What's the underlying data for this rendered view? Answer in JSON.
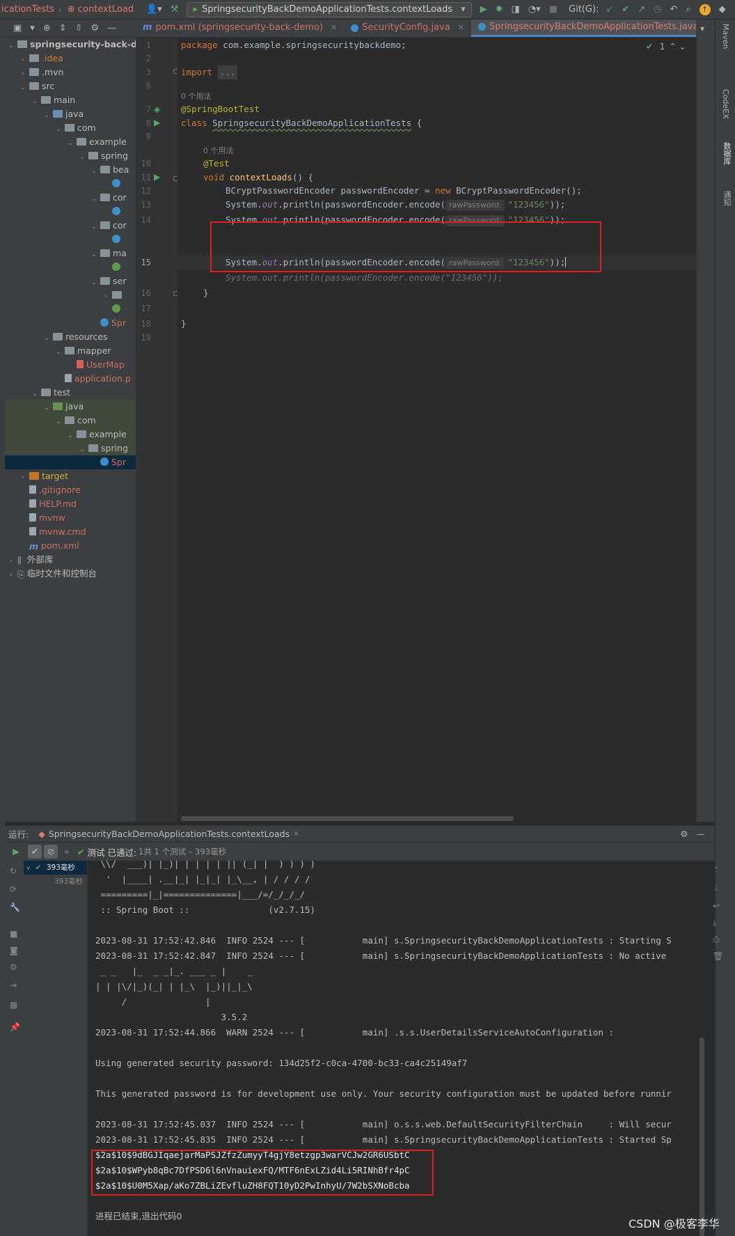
{
  "toolbar": {
    "breadcrumb_file": "icationTests",
    "breadcrumb_method": "contextLoad",
    "run_config": "SpringsecurityBackDemoApplicationTests.contextLoads",
    "git_label": "Git(G):"
  },
  "project_tree": [
    {
      "indent": 0,
      "arrow": "v",
      "icon": "folder",
      "label": "springsecurity-back-demo",
      "bold": true
    },
    {
      "indent": 1,
      "arrow": ">",
      "icon": "folder",
      "label": ".idea",
      "color": "orange"
    },
    {
      "indent": 1,
      "arrow": ">",
      "icon": "folder",
      "label": ".mvn"
    },
    {
      "indent": 1,
      "arrow": "v",
      "icon": "folder",
      "label": "src"
    },
    {
      "indent": 2,
      "arrow": "v",
      "icon": "folder",
      "label": "main"
    },
    {
      "indent": 3,
      "arrow": "v",
      "icon": "folder-blue",
      "label": "java"
    },
    {
      "indent": 4,
      "arrow": "v",
      "icon": "folder",
      "label": "com"
    },
    {
      "indent": 5,
      "arrow": "v",
      "icon": "folder",
      "label": "example"
    },
    {
      "indent": 6,
      "arrow": "v",
      "icon": "folder",
      "label": "spring"
    },
    {
      "indent": 7,
      "arrow": "v",
      "icon": "folder",
      "label": "bea"
    },
    {
      "indent": 8,
      "arrow": "",
      "icon": "class",
      "label": ""
    },
    {
      "indent": 7,
      "arrow": "v",
      "icon": "folder",
      "label": "cor"
    },
    {
      "indent": 8,
      "arrow": "",
      "icon": "class",
      "label": ""
    },
    {
      "indent": 7,
      "arrow": "v",
      "icon": "folder",
      "label": "cor"
    },
    {
      "indent": 8,
      "arrow": "",
      "icon": "class",
      "label": ""
    },
    {
      "indent": 7,
      "arrow": "v",
      "icon": "folder",
      "label": "ma"
    },
    {
      "indent": 8,
      "arrow": "",
      "icon": "iface",
      "label": ""
    },
    {
      "indent": 7,
      "arrow": "v",
      "icon": "folder",
      "label": "ser"
    },
    {
      "indent": 8,
      "arrow": ">",
      "icon": "folder",
      "label": ""
    },
    {
      "indent": 8,
      "arrow": "",
      "icon": "iface",
      "label": ""
    },
    {
      "indent": 7,
      "arrow": "",
      "icon": "class",
      "label": "Spr",
      "color": "red"
    },
    {
      "indent": 3,
      "arrow": "v",
      "icon": "folder",
      "label": "resources"
    },
    {
      "indent": 4,
      "arrow": "v",
      "icon": "folder",
      "label": "mapper"
    },
    {
      "indent": 5,
      "arrow": "",
      "icon": "xml",
      "label": "UserMap",
      "color": "red"
    },
    {
      "indent": 4,
      "arrow": "",
      "icon": "file",
      "label": "application.p",
      "color": "red"
    },
    {
      "indent": 2,
      "arrow": "v",
      "icon": "folder",
      "label": "test"
    },
    {
      "indent": 3,
      "arrow": "v",
      "icon": "folder-green",
      "label": "java",
      "hl": "green"
    },
    {
      "indent": 4,
      "arrow": "v",
      "icon": "folder",
      "label": "com",
      "hl": "green"
    },
    {
      "indent": 5,
      "arrow": "v",
      "icon": "folder",
      "label": "example",
      "hl": "green"
    },
    {
      "indent": 6,
      "arrow": "v",
      "icon": "folder",
      "label": "spring",
      "hl": "green"
    },
    {
      "indent": 7,
      "arrow": "",
      "icon": "class",
      "label": "Spr",
      "color": "red",
      "hl": "sel"
    },
    {
      "indent": 1,
      "arrow": ">",
      "icon": "folder-orange",
      "label": "target",
      "color": "yellow"
    },
    {
      "indent": 1,
      "arrow": "",
      "icon": "file",
      "label": ".gitignore",
      "color": "red"
    },
    {
      "indent": 1,
      "arrow": "",
      "icon": "file",
      "label": "HELP.md",
      "color": "red"
    },
    {
      "indent": 1,
      "arrow": "",
      "icon": "file",
      "label": "mvnw",
      "color": "red"
    },
    {
      "indent": 1,
      "arrow": "",
      "icon": "file",
      "label": "mvnw.cmd",
      "color": "red"
    },
    {
      "indent": 1,
      "arrow": "",
      "icon": "m",
      "label": "pom.xml",
      "color": "red"
    },
    {
      "indent": 0,
      "arrow": ">",
      "icon": "lib",
      "label": "外部库"
    },
    {
      "indent": 0,
      "arrow": ">",
      "icon": "scratch",
      "label": "临时文件和控制台"
    }
  ],
  "editor_tabs": [
    {
      "icon": "m",
      "label": "pom.xml (springsecurity-back-demo)",
      "active": false
    },
    {
      "icon": "class",
      "label": "SecurityConfig.java",
      "active": false
    },
    {
      "icon": "class",
      "label": "SpringsecurityBackDemoApplicationTests.java",
      "active": true
    }
  ],
  "editor": {
    "inspection_count": "1",
    "package_kw": "package",
    "package_name": "com.example.springsecuritybackdemo;",
    "import_kw": "import",
    "import_fold": "...",
    "usages_0": "0 个用法",
    "annotation_boot": "@SpringBootTest",
    "class_kw": "class",
    "class_name": "SpringsecurityBackDemoApplicationTests",
    "brace_open": " {",
    "annotation_test": "@Test",
    "void_kw": "void",
    "method_name": "contextLoads",
    "method_tail": "() {",
    "encoder_decl_type": "BCryptPasswordEncoder passwordEncoder = ",
    "new_kw": "new",
    "encoder_ctor": " BCryptPasswordEncoder();",
    "print_prefix": "System.",
    "print_out": "out",
    "print_mid": ".println(passwordEncoder.encode(",
    "param_hint": "rawPassword:",
    "pwd_literal": "\"123456\"",
    "print_end": "));",
    "ghost_line": "System.out.println(passwordEncoder.encode(\"123456\"));",
    "close_brace": "}",
    "line_numbers": [
      "1",
      "2",
      "3",
      "6",
      "7",
      "8",
      "9",
      "10",
      "11",
      "12",
      "13",
      "14",
      "15",
      "16",
      "17",
      "18",
      "19"
    ]
  },
  "run_panel": {
    "label": "运行:",
    "tab": "SpringsecurityBackDemoApplicationTests.contextLoads",
    "status_prefix": "测试 已通过:",
    "status_detail": "1共 1 个测试 – 393毫秒",
    "tree_item_1": "393毫秒",
    "tree_item_2": "393毫秒",
    "console_lines": [
      " \\\\/  ___)| |_)| | | | | || (_| |  ) ) ) )",
      "  '  |____| .__|_| |_|_| |_\\__, | / / / /",
      " =========|_|==============|___/=/_/_/_/",
      " :: Spring Boot ::               (v2.7.15)",
      "",
      "2023-08-31 17:52:42.846  INFO 2524 --- [           main] s.SpringsecurityBackDemoApplicationTests : Starting S",
      "2023-08-31 17:52:42.847  INFO 2524 --- [           main] s.SpringsecurityBackDemoApplicationTests : No active",
      " _ _   |_  _ _|_. ___ _ |    _",
      "| | |\\/|_)(_| | |_\\  |_)||_|_\\",
      "     /               |",
      "                        3.5.2",
      "2023-08-31 17:52:44.866  WARN 2524 --- [           main] .s.s.UserDetailsServiceAutoConfiguration :",
      "",
      "Using generated security password: 134d25f2-c0ca-4700-bc33-ca4c25149af7",
      "",
      "This generated password is for development use only. Your security configuration must be updated before runnir",
      "",
      "2023-08-31 17:52:45.037  INFO 2524 --- [           main] o.s.s.web.DefaultSecurityFilterChain     : Will secur",
      "2023-08-31 17:52:45.835  INFO 2524 --- [           main] s.SpringsecurityBackDemoApplicationTests : Started Sp"
    ],
    "hash_lines": [
      "$2a$10$9dBGJIqaejarMaPSJZfzZumyyT4gjY8etzgp3warVCJw2GR6USbtC",
      "$2a$10$WPyb8qBc7DfPSD6l6nVnauiexFQ/MTF6nExLZid4Li5RINhBfr4pC",
      "$2a$10$U0M5Xap/aKo7ZBLiZEvfluZH8FQT10yD2PwInhyU/7W2bSXNoBcba"
    ],
    "exit_line": "进程已结束,退出代码0"
  },
  "watermark": "CSDN @极客李华",
  "right_strip": {
    "maven": "Maven",
    "codeex": "CodeEX",
    "db": "数据库",
    "notify": "通知"
  }
}
